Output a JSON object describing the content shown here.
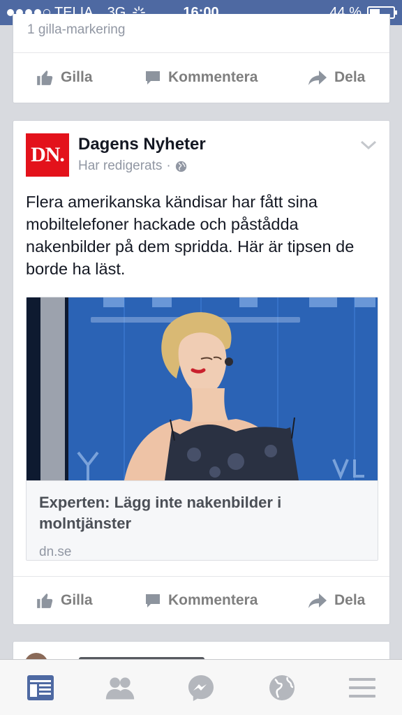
{
  "status_bar": {
    "carrier": "TELIA",
    "network": "3G",
    "time": "16:00",
    "battery": "44 %",
    "battery_level": 0.44
  },
  "prev_post": {
    "likes_text": "1 gilla-markering",
    "actions": {
      "like": "Gilla",
      "comment": "Kommentera",
      "share": "Dela"
    }
  },
  "post": {
    "page_name": "Dagens Nyheter",
    "logo_text": "DN.",
    "meta": "Har redigerats",
    "text": "Flera amerikanska kändisar har fått sina mobiltelefoner hackade och påstådda nakenbilder på dem spridda. Här är tipsen de borde ha läst.",
    "link": {
      "title": "Experten: Lägg inte nakenbilder i molntjänster",
      "domain": "dn.se"
    },
    "actions": {
      "like": "Gilla",
      "comment": "Kommentera",
      "share": "Dela"
    }
  },
  "tabbar": {
    "tabs": [
      "news-feed",
      "friends",
      "messenger",
      "notifications",
      "more"
    ]
  },
  "colors": {
    "status_bar": "#4e69a2",
    "dn_red": "#e3121b",
    "active_tab": "#4e69a2"
  }
}
